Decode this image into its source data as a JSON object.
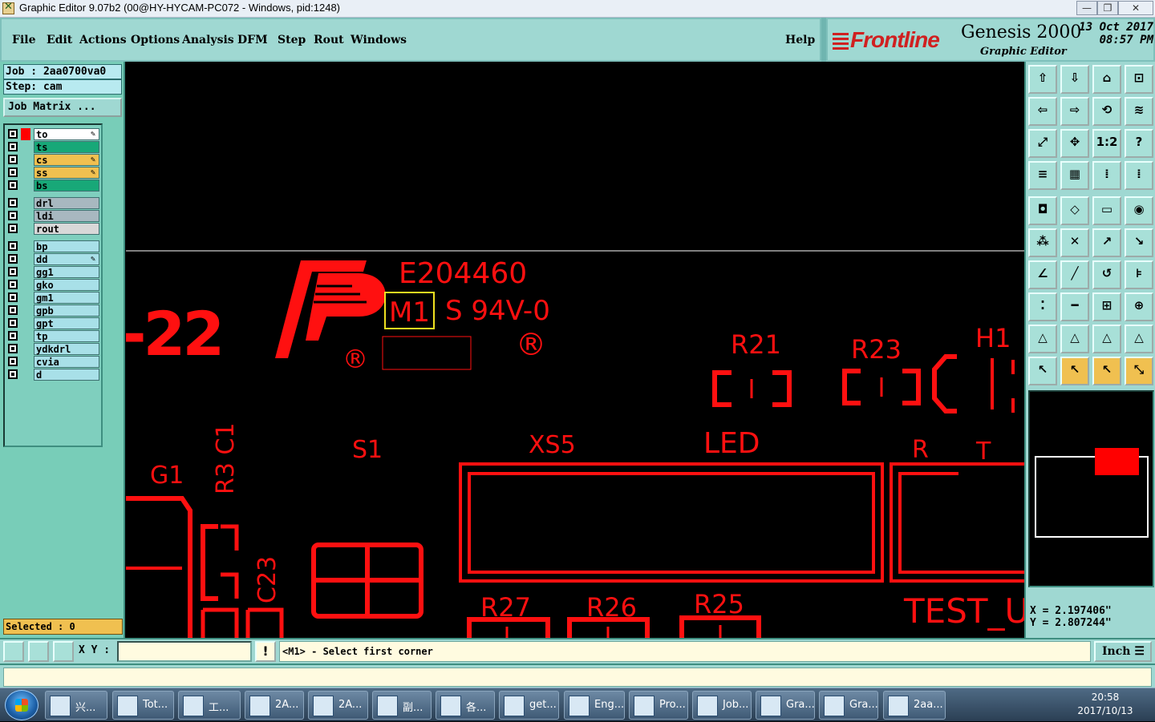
{
  "window": {
    "title": "Graphic Editor 9.07b2 (00@HY-HYCAM-PC072 - Windows, pid:1248)",
    "min": "—",
    "max": "❐",
    "close": "✕"
  },
  "menu": {
    "items": [
      "File",
      "Edit",
      "Actions",
      "Options",
      "Analysis",
      "DFM",
      "Step",
      "Rout",
      "Windows"
    ],
    "help": "Help"
  },
  "brand": {
    "logo": "Frontline",
    "product": "Genesis 2000",
    "subtitle": "Graphic Editor",
    "date": "13 Oct 2017",
    "time": "08:57 PM"
  },
  "job": {
    "job_line": "Job : 2aa0700va0",
    "step_line": "Step: cam",
    "matrix_button": "Job Matrix ...",
    "selected": "Selected : 0"
  },
  "layers": [
    {
      "name": "to",
      "color": "#ffffff",
      "edit": true,
      "group": 0
    },
    {
      "name": "ts",
      "color": "#18a878",
      "edit": false,
      "group": 0
    },
    {
      "name": "cs",
      "color": "#f0c050",
      "edit": true,
      "group": 0
    },
    {
      "name": "ss",
      "color": "#f0c050",
      "edit": true,
      "group": 0
    },
    {
      "name": "bs",
      "color": "#18a878",
      "edit": false,
      "group": 0
    },
    {
      "name": "drl",
      "color": "#a8b8c0",
      "edit": false,
      "group": 1
    },
    {
      "name": "ldi",
      "color": "#a8b8c0",
      "edit": false,
      "group": 1
    },
    {
      "name": "rout",
      "color": "#d8d8d8",
      "edit": false,
      "group": 1
    },
    {
      "name": "bp",
      "color": "#a8e0e8",
      "edit": false,
      "group": 2
    },
    {
      "name": "dd",
      "color": "#a8e0e8",
      "edit": true,
      "group": 2
    },
    {
      "name": "gg1",
      "color": "#a8e0e8",
      "edit": false,
      "group": 2
    },
    {
      "name": "gko",
      "color": "#a8e0e8",
      "edit": false,
      "group": 2
    },
    {
      "name": "gm1",
      "color": "#a8e0e8",
      "edit": false,
      "group": 2
    },
    {
      "name": "gpb",
      "color": "#a8e0e8",
      "edit": false,
      "group": 2
    },
    {
      "name": "gpt",
      "color": "#a8e0e8",
      "edit": false,
      "group": 2
    },
    {
      "name": "tp",
      "color": "#a8e0e8",
      "edit": false,
      "group": 2
    },
    {
      "name": "ydkdrl",
      "color": "#a8e0e8",
      "edit": false,
      "group": 2
    },
    {
      "name": "cvia",
      "color": "#a8e0e8",
      "edit": false,
      "group": 2
    },
    {
      "name": "d",
      "color": "#a8e0e8",
      "edit": false,
      "group": 2
    }
  ],
  "canvas": {
    "labels": {
      "e204460": "E204460",
      "m1": "M1",
      "s94v0": "S 94V-0",
      "num22": "-22",
      "r21": "R21",
      "r23": "R23",
      "h1": "H1",
      "g1": "G1",
      "r3c1": "R3 C1",
      "c23": "C23",
      "s1": "S1",
      "xs5": "XS5",
      "led": "LED",
      "r": "R",
      "t": "T",
      "r27": "R27",
      "r26": "R26",
      "r25": "R25",
      "test": "TEST_U",
      "reg1": "®",
      "reg2": "®"
    },
    "trace_color": "#ff1010",
    "highlight_color": "#f0e020"
  },
  "coords": {
    "x": "X = 2.197406\"",
    "y": "Y = 2.807244\""
  },
  "bottom": {
    "xy_label": "X Y :",
    "xy_value": "",
    "bang": "!",
    "prompt": "<M1> - Select first corner",
    "unit": "Inch"
  },
  "taskbar": {
    "tasks": [
      "兴...",
      "Tot...",
      "工...",
      "2A...",
      "2A...",
      "副...",
      "各...",
      "get...",
      "Eng...",
      "Pro...",
      "Job...",
      "Gra...",
      "Gra...",
      "2aa..."
    ],
    "clock_time": "20:58",
    "clock_date": "2017/10/13"
  }
}
